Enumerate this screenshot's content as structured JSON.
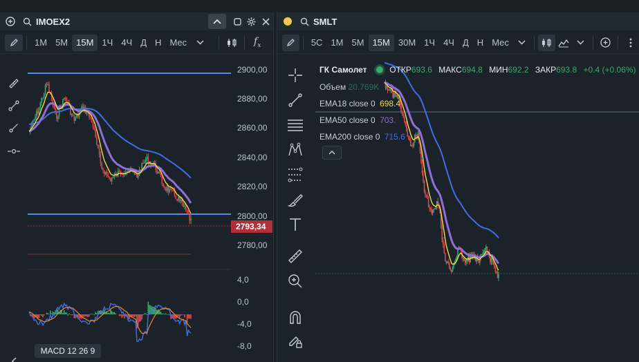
{
  "left": {
    "ticker": "IMOEX2",
    "timeframes": [
      "1М",
      "5М",
      "15М",
      "1Ч",
      "4Ч",
      "Д",
      "Н",
      "Мес"
    ],
    "active_timeframe": "15М",
    "price_axis": [
      "2900,00",
      "2880,00",
      "2860,00",
      "2840,00",
      "2820,00",
      "2800,00",
      "2780,00"
    ],
    "current_price": "2793,34",
    "macd_axis": [
      "4,0",
      "0,0",
      "-4,0",
      "-8,0"
    ],
    "macd_label": "MACD 12 26 9"
  },
  "right": {
    "ticker": "SMLT",
    "timeframes": [
      "5С",
      "1М",
      "5М",
      "15М",
      "30М",
      "1Ч",
      "4Ч",
      "Д",
      "Н",
      "Мес"
    ],
    "active_timeframe": "15М",
    "legend": {
      "name": "ГК Самолет",
      "open_label": "ОТКР",
      "open_value": "693.6",
      "high_label": "МАКС",
      "high_value": "694.8",
      "low_label": "МИН",
      "low_value": "692.2",
      "close_label": "ЗАКР",
      "close_value": "693.8",
      "change": "+0.4 (+0.06%)",
      "volume_label": "Объем",
      "volume_value": "20.769K",
      "ema18_label": "EMA18 close 0",
      "ema18_value": "698.4",
      "ema50_label": "EMA50 close 0",
      "ema50_value": "703.",
      "ema200_label": "EMA200 close 0",
      "ema200_value": "715.6"
    }
  },
  "colors": {
    "blue_line": "#4f8ff0",
    "ema18": "#f2d94a",
    "ema50": "#8e6fd8",
    "ema200": "#3f6fe0",
    "price_badge": "#b0303a",
    "up": "#3aa870",
    "down": "#d9474f"
  }
}
